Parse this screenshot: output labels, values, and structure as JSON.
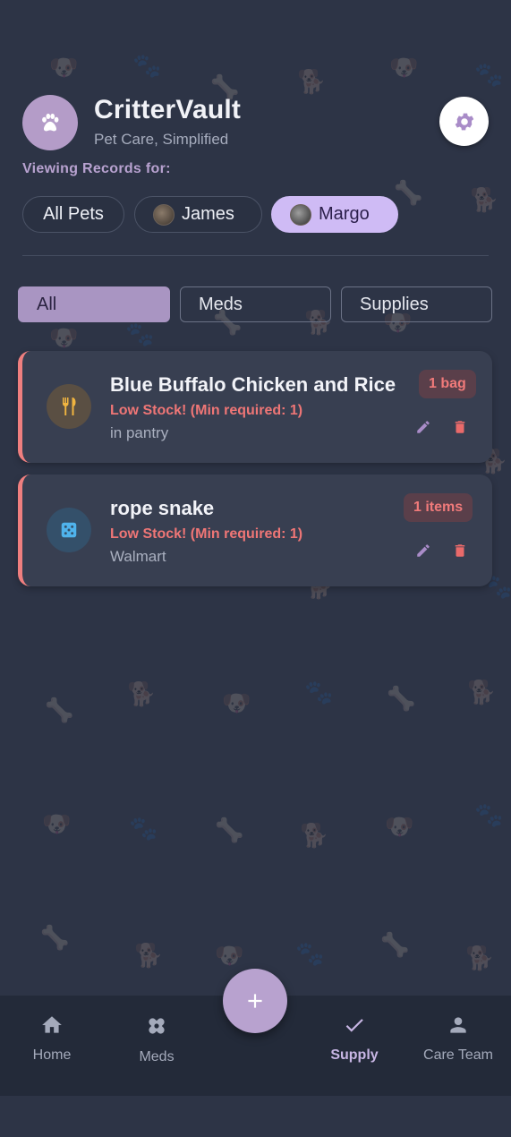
{
  "app": {
    "title": "CritterVault",
    "subtitle": "Pet Care, Simplified",
    "logo_icon": "paw-icon",
    "settings_icon": "gear-icon"
  },
  "filters": {
    "viewing_label": "Viewing Records for:",
    "pets": [
      {
        "label": "All Pets",
        "active": false
      },
      {
        "label": "James",
        "active": false
      },
      {
        "label": "Margo",
        "active": true
      }
    ]
  },
  "tabs": [
    {
      "label": "All",
      "active": true
    },
    {
      "label": "Meds",
      "active": false
    },
    {
      "label": "Supplies",
      "active": false
    }
  ],
  "supplies": [
    {
      "name": "Blue Buffalo Chicken and Rice",
      "warning": "Low Stock! (Min required: 1)",
      "location": "in pantry",
      "quantity": "1 bag",
      "icon": "fork-knife-icon"
    },
    {
      "name": "rope snake",
      "warning": "Low Stock! (Min required: 1)",
      "location": "Walmart",
      "quantity": "1 items",
      "icon": "dice-icon"
    }
  ],
  "nav": {
    "items": [
      {
        "label": "Home",
        "icon": "home-icon",
        "active": false
      },
      {
        "label": "Meds",
        "icon": "bandage-icon",
        "active": false
      },
      {
        "label": "Supply",
        "icon": "check-icon",
        "active": true
      },
      {
        "label": "Care Team",
        "icon": "person-icon",
        "active": false
      }
    ],
    "fab_icon": "plus-icon"
  },
  "colors": {
    "background": "#2d3446",
    "accent": "#cfbbf5",
    "warning": "#ef7676",
    "card": "#383f51"
  }
}
